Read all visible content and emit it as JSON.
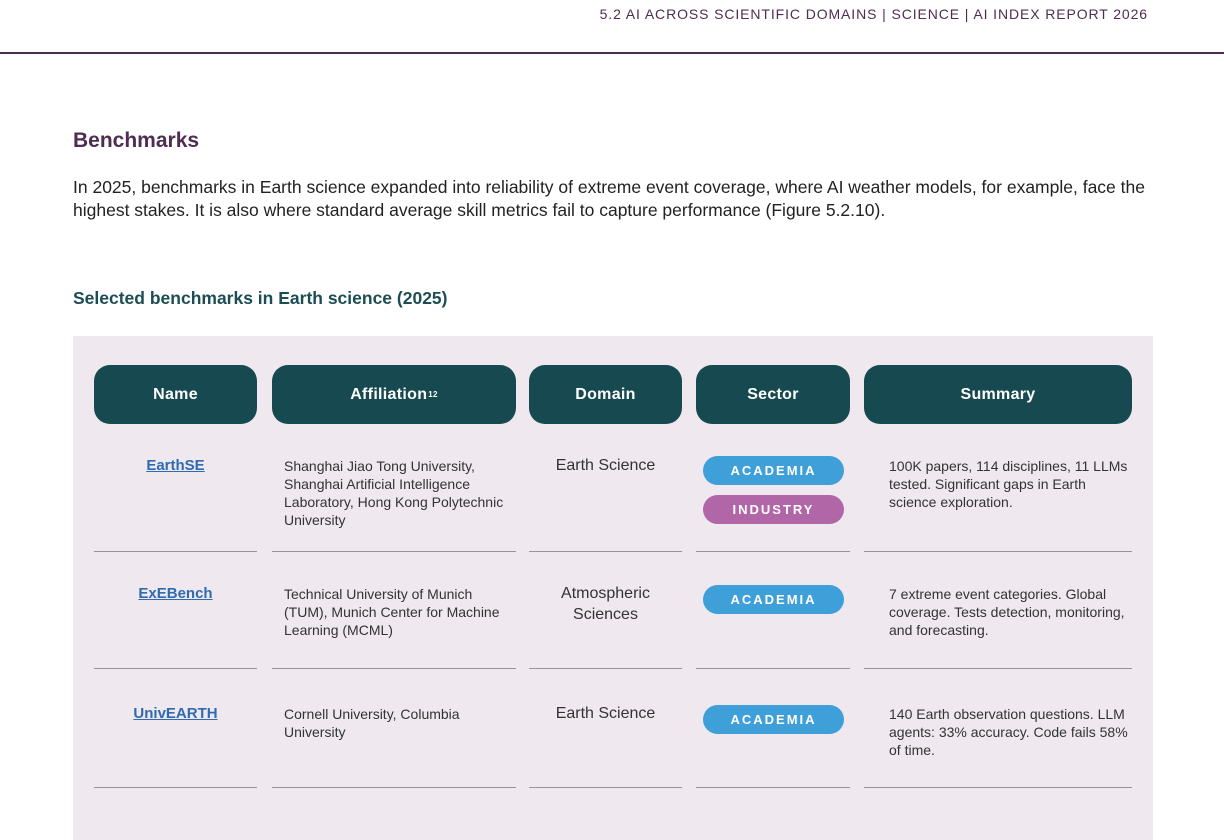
{
  "header": {
    "running_title": "5.2 AI ACROSS SCIENTIFIC DOMAINS  |  SCIENCE  |  AI INDEX REPORT 2026"
  },
  "section": {
    "heading": "Benchmarks",
    "paragraph": "In 2025, benchmarks in Earth science expanded into reliability of extreme event coverage, where AI weather models, for example, face the highest stakes. It is also where standard average skill metrics fail to capture performance (Figure 5.2.10)."
  },
  "figure": {
    "title": "Selected benchmarks in Earth science (2025)"
  },
  "table": {
    "columns": {
      "name": "Name",
      "affiliation": "Affiliation",
      "affiliation_footnote": "12",
      "domain": "Domain",
      "sector": "Sector",
      "summary": "Summary"
    },
    "rows": [
      {
        "name": "EarthSE",
        "affiliation": "Shanghai Jiao Tong University, Shanghai Artificial Intelligence Laboratory, Hong Kong Polytechnic University",
        "domain": "Earth Science",
        "sectors": [
          "ACADEMIA",
          "INDUSTRY"
        ],
        "summary": "100K papers, 114 disciplines, 11 LLMs tested. Significant gaps in Earth science exploration."
      },
      {
        "name": "ExEBench",
        "affiliation": "Technical University of Munich (TUM), Munich Center for Machine Learning (MCML)",
        "domain": "Atmospheric Sciences",
        "sectors": [
          "ACADEMIA"
        ],
        "summary": "7 extreme event categories. Global coverage. Tests detection, monitoring, and forecasting."
      },
      {
        "name": "UnivEARTH",
        "affiliation": "Cornell University, Columbia University",
        "domain": "Earth Science",
        "sectors": [
          "ACADEMIA"
        ],
        "summary": "140 Earth observation questions. LLM agents: 33% accuracy. Code fails 58% of time."
      }
    ]
  },
  "colors": {
    "header_fill": "#174a50",
    "accent_purple": "#4f2d52",
    "academia_badge": "#3e9fd9",
    "industry_badge": "#b166a8",
    "link": "#2e6bb0",
    "panel_bg": "#efe8ef"
  }
}
